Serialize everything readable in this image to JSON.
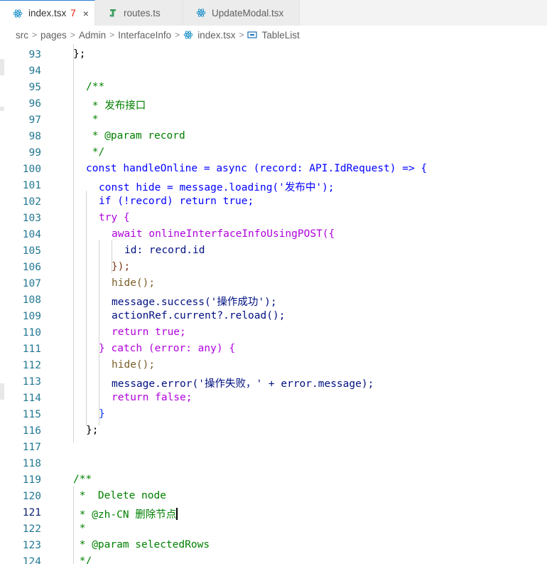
{
  "tabs": [
    {
      "label": "index.tsx",
      "badge": "7",
      "close": "×",
      "icon": "react-icon"
    },
    {
      "label": "routes.ts",
      "icon": "typescript-icon"
    },
    {
      "label": "UpdateModal.tsx",
      "icon": "react-icon"
    }
  ],
  "breadcrumb": [
    "src",
    "pages",
    "Admin",
    "InterfaceInfo",
    "index.tsx",
    "TableList"
  ],
  "colors": {
    "accent": "#2a7bd3",
    "line_number": "#237893",
    "comment": "#008000",
    "keyword": "#0000ff",
    "string": "#a31515"
  },
  "editor": {
    "lines": [
      {
        "n": "93",
        "text": "};"
      },
      {
        "n": "94",
        "text": ""
      },
      {
        "n": "95",
        "text": "/**"
      },
      {
        "n": "96",
        "text": " * 发布接口"
      },
      {
        "n": "97",
        "text": " *"
      },
      {
        "n": "98",
        "text": " * @param record"
      },
      {
        "n": "99",
        "text": " */"
      },
      {
        "n": "100",
        "text": "const handleOnline = async (record: API.IdRequest) => {"
      },
      {
        "n": "101",
        "text": "const hide = message.loading('发布中');"
      },
      {
        "n": "102",
        "text": "if (!record) return true;"
      },
      {
        "n": "103",
        "text": "try {"
      },
      {
        "n": "104",
        "text": "await onlineInterfaceInfoUsingPOST({"
      },
      {
        "n": "105",
        "text": "id: record.id"
      },
      {
        "n": "106",
        "text": "});"
      },
      {
        "n": "107",
        "text": "hide();"
      },
      {
        "n": "108",
        "text": "message.success('操作成功');"
      },
      {
        "n": "109",
        "text": "actionRef.current?.reload();"
      },
      {
        "n": "110",
        "text": "return true;"
      },
      {
        "n": "111",
        "text": "} catch (error: any) {"
      },
      {
        "n": "112",
        "text": "hide();"
      },
      {
        "n": "113",
        "text": "message.error('操作失败，' + error.message);"
      },
      {
        "n": "114",
        "text": "return false;"
      },
      {
        "n": "115",
        "text": "}"
      },
      {
        "n": "116",
        "text": "};"
      },
      {
        "n": "117",
        "text": ""
      },
      {
        "n": "118",
        "text": ""
      },
      {
        "n": "119",
        "text": "/**"
      },
      {
        "n": "120",
        "text": " *  Delete node"
      },
      {
        "n": "121",
        "text": " * @zh-CN 删除节点"
      },
      {
        "n": "122",
        "text": " *"
      },
      {
        "n": "123",
        "text": " * @param selectedRows"
      },
      {
        "n": "124",
        "text": " */"
      }
    ]
  }
}
